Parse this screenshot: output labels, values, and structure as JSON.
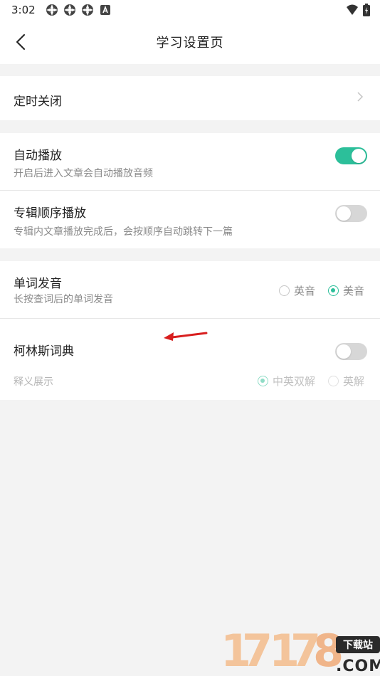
{
  "status_bar": {
    "time": "3:02"
  },
  "header": {
    "title": "学习设置页"
  },
  "settings": {
    "timer_close": {
      "title": "定时关闭"
    },
    "auto_play": {
      "title": "自动播放",
      "subtitle": "开启后进入文章会自动播放音频",
      "enabled": true
    },
    "album_sequence": {
      "title": "专辑顺序播放",
      "subtitle": "专辑内文章播放完成后，会按顺序自动跳转下一篇",
      "enabled": false
    },
    "pronunciation": {
      "title": "单词发音",
      "subtitle": "长按查词后的单词发音",
      "options": [
        {
          "label": "英音",
          "checked": false
        },
        {
          "label": "美音",
          "checked": true
        }
      ]
    },
    "collins": {
      "title": "柯林斯词典",
      "enabled": false,
      "display_label": "释义展示",
      "options": [
        {
          "label": "中英双解",
          "checked": true
        },
        {
          "label": "英解",
          "checked": false
        }
      ]
    }
  },
  "watermark": {
    "digits": [
      "1",
      "7",
      "1",
      "7",
      "8"
    ],
    "tag": "下载站",
    "suffix": ".COM"
  },
  "colors": {
    "accent": "#2cbf9a",
    "toggle_off": "#d7d7d7",
    "annotation_arrow": "#d81e1e"
  }
}
